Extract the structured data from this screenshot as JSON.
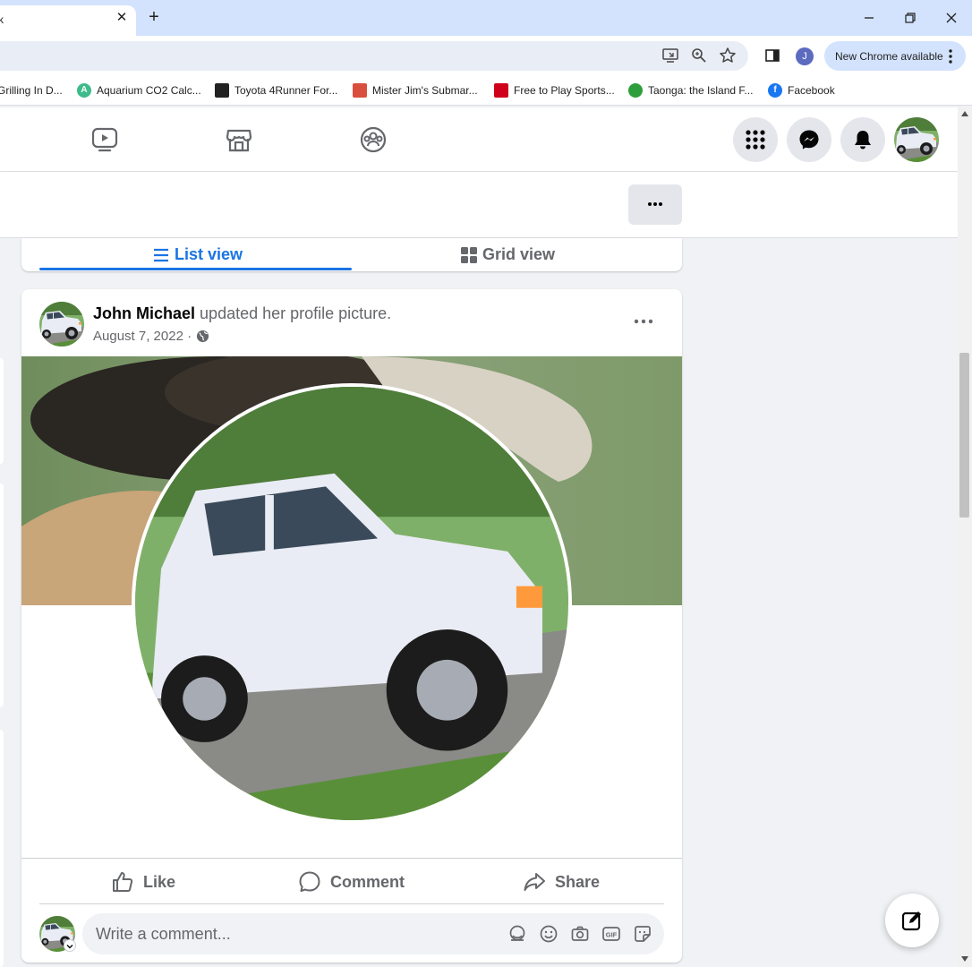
{
  "browser": {
    "tab": {
      "title": "k",
      "close_glyph": "✕"
    },
    "new_tab_glyph": "+",
    "toolbar": {
      "icons": [
        "cast-icon",
        "zoom-icon",
        "bookmark-star-icon",
        "side-panel-icon"
      ],
      "profile_initial": "J",
      "update_label": "New Chrome available"
    },
    "bookmarks": [
      {
        "label": "Grilling In D...",
        "icon": "grill-favicon",
        "color": "#c0392b"
      },
      {
        "label": "Aquarium CO2 Calc...",
        "icon": "aquarium-favicon",
        "color": "#3dbb8a"
      },
      {
        "label": "Toyota 4Runner For...",
        "icon": "toyota-forum-favicon",
        "color": "#222222"
      },
      {
        "label": "Mister Jim's Submar...",
        "icon": "mister-jims-favicon",
        "color": "#d94f3d"
      },
      {
        "label": "Free to Play Sports...",
        "icon": "espn-favicon",
        "color": "#d0021b"
      },
      {
        "label": "Taonga: the Island F...",
        "icon": "taonga-favicon",
        "color": "#2e9e3c"
      },
      {
        "label": "Facebook",
        "icon": "facebook-favicon",
        "color": "#1877f2"
      }
    ]
  },
  "facebook": {
    "nav_icons": [
      "watch-icon",
      "marketplace-icon",
      "groups-icon"
    ],
    "header_buttons": [
      "menu-grid-icon",
      "messenger-icon",
      "notifications-bell-icon"
    ],
    "view_toggle": {
      "list_label": "List view",
      "grid_label": "Grid view",
      "active": "List view"
    },
    "post": {
      "author": "John Michael",
      "action": "updated her profile picture.",
      "date": "August 7, 2022 ·",
      "privacy_icon": "globe-icon",
      "actions": {
        "like": "Like",
        "comment": "Comment",
        "share": "Share"
      },
      "comment_placeholder": "Write a comment...",
      "comment_icons": [
        "avatar-sticker-icon",
        "emoji-icon",
        "camera-icon",
        "gif-icon",
        "sticker-icon"
      ]
    },
    "colors": {
      "accent": "#1b74e4",
      "muted": "#65676b",
      "background": "#f0f2f5"
    }
  }
}
